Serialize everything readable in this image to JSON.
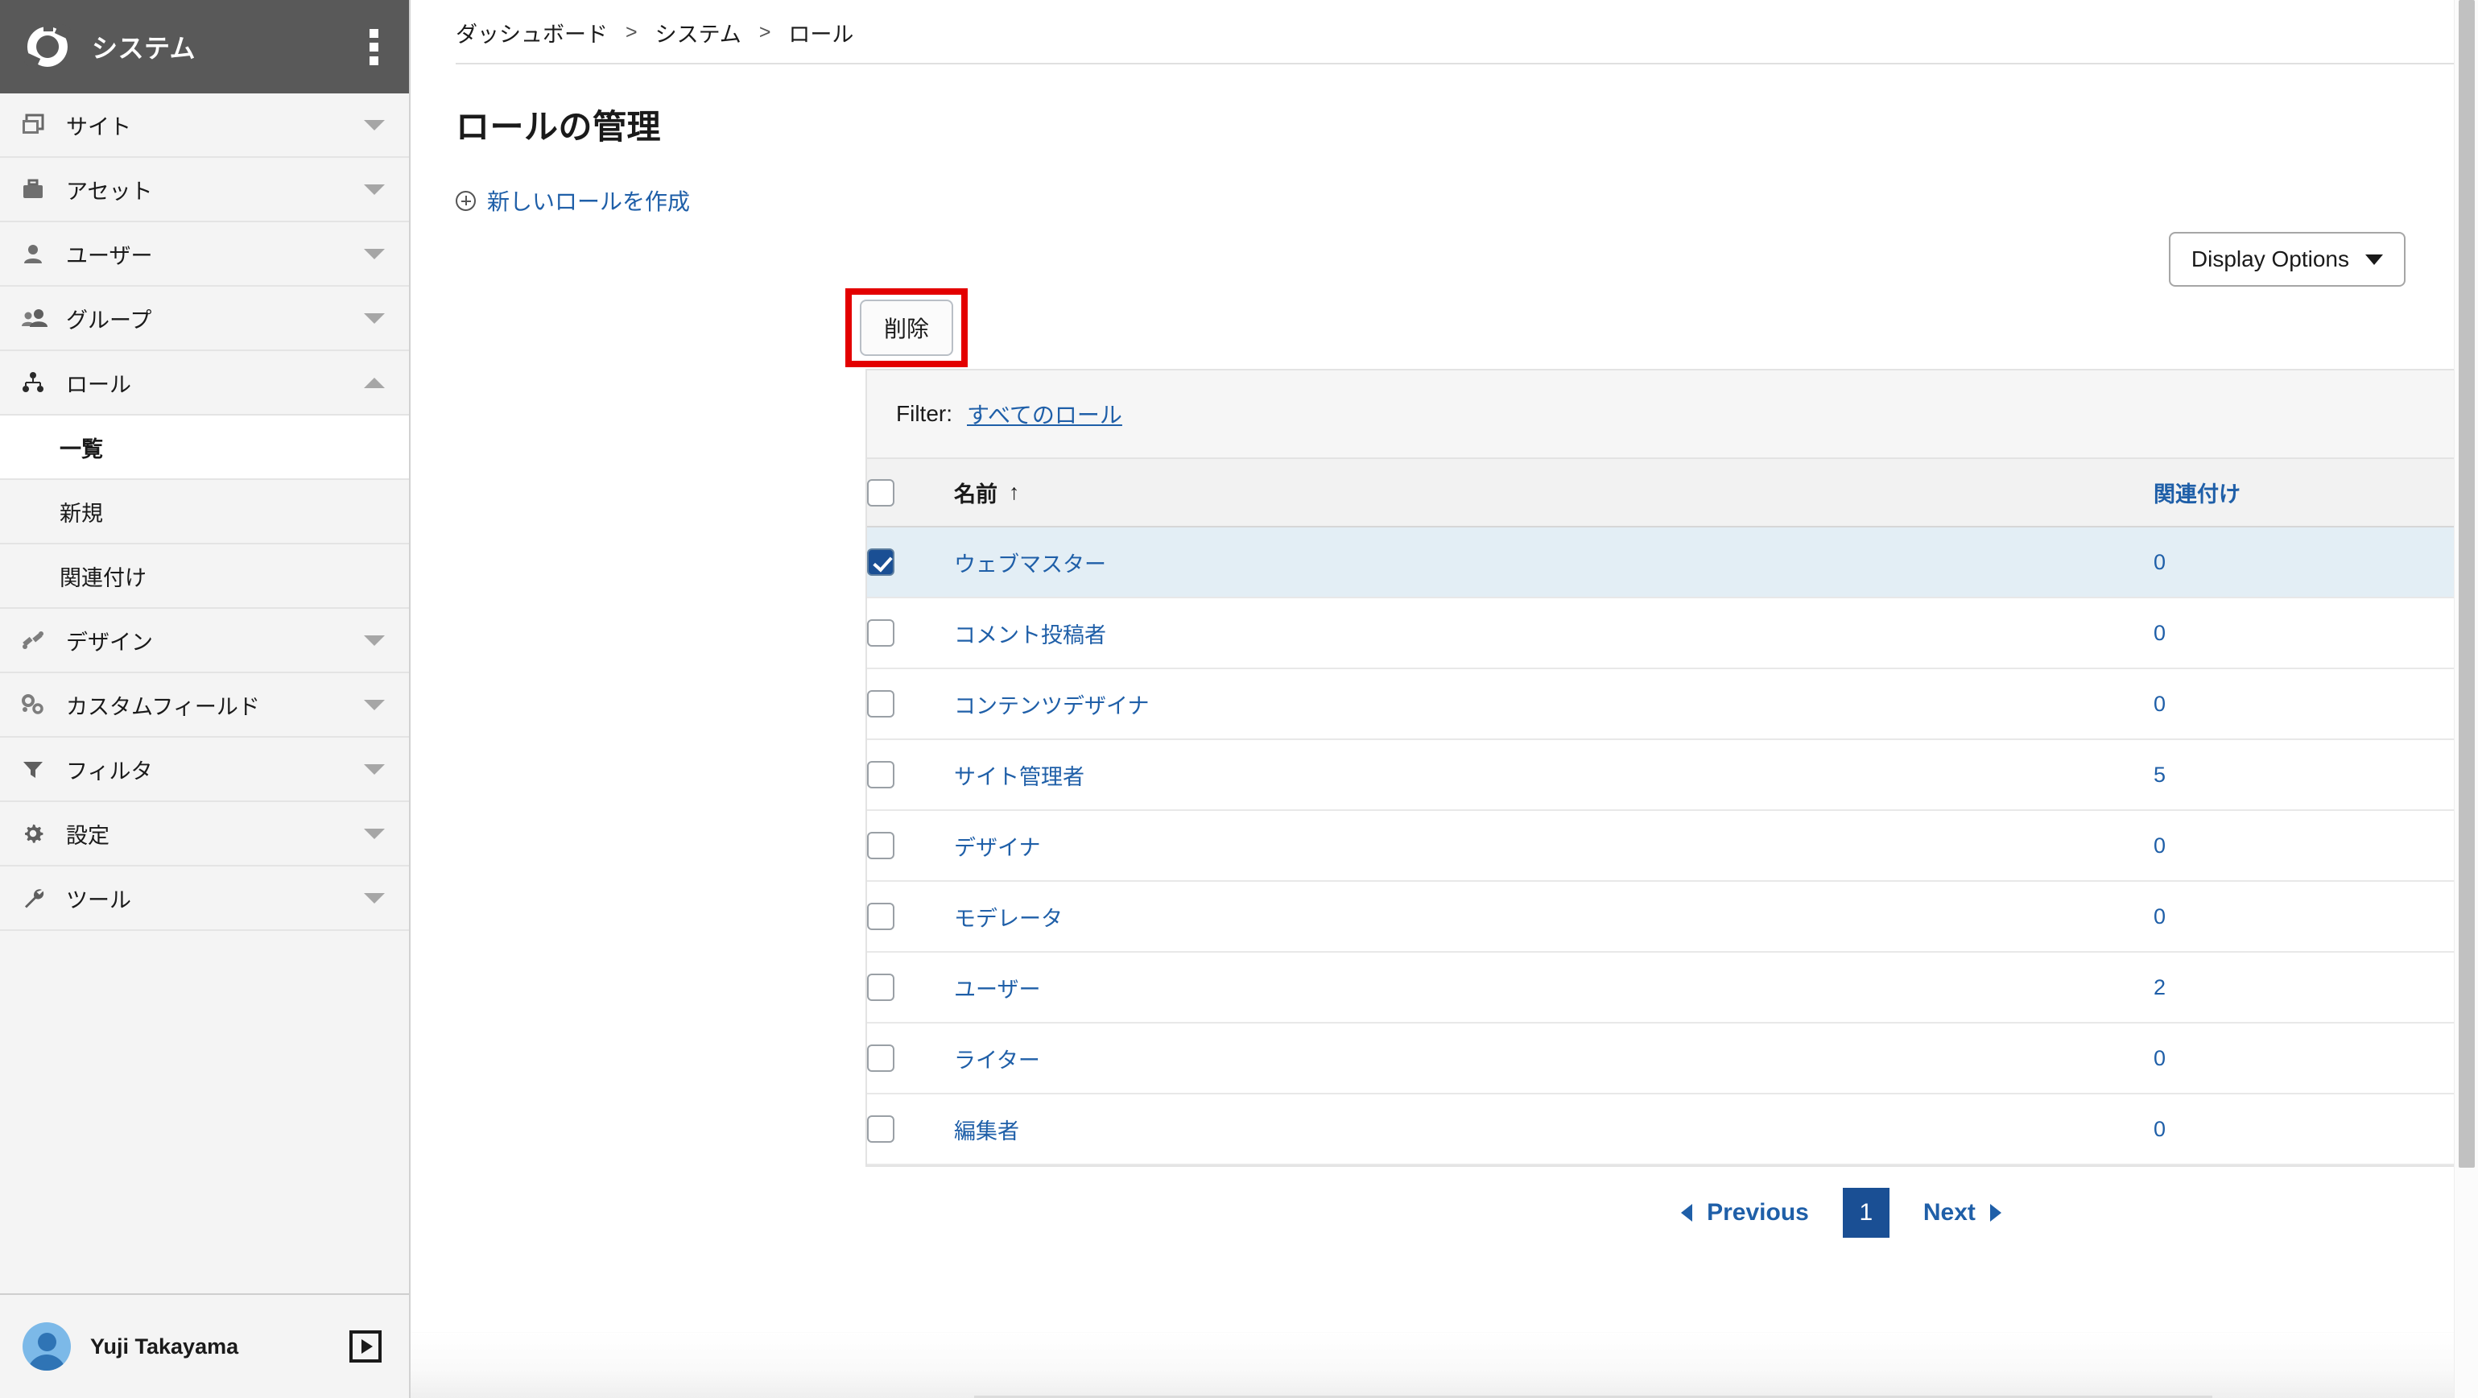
{
  "sidebar": {
    "brand": {
      "title": "システム",
      "logo_icon": "ring-logo-icon",
      "menu_icon": "kebab-menu-icon"
    },
    "items": [
      {
        "label": "サイト",
        "icon": "pages-icon",
        "expanded": false
      },
      {
        "label": "アセット",
        "icon": "briefcase-icon",
        "expanded": false
      },
      {
        "label": "ユーザー",
        "icon": "user-icon",
        "expanded": false
      },
      {
        "label": "グループ",
        "icon": "group-icon",
        "expanded": false
      },
      {
        "label": "ロール",
        "icon": "roles-tree-icon",
        "expanded": true
      },
      {
        "label": "デザイン",
        "icon": "design-icon",
        "expanded": false
      },
      {
        "label": "カスタムフィールド",
        "icon": "custom-fields-icon",
        "expanded": false
      },
      {
        "label": "フィルタ",
        "icon": "filter-funnel-icon",
        "expanded": false
      },
      {
        "label": "設定",
        "icon": "gear-icon",
        "expanded": false
      },
      {
        "label": "ツール",
        "icon": "wrench-icon",
        "expanded": false
      }
    ],
    "roles_subitems": [
      {
        "label": "一覧",
        "active": true
      },
      {
        "label": "新規",
        "active": false
      },
      {
        "label": "関連付け",
        "active": false
      }
    ],
    "footer": {
      "user_name": "Yuji Takayama",
      "avatar_icon": "user-avatar-icon",
      "logout_icon": "logout-arrow-icon"
    }
  },
  "breadcrumb": {
    "items": [
      "ダッシュボード",
      "システム",
      "ロール"
    ],
    "separator": ">"
  },
  "page": {
    "title": "ロールの管理",
    "create_link": "新しいロールを作成",
    "create_icon": "plus-circle-icon"
  },
  "toolbar": {
    "display_options_label": "Display Options",
    "display_options_icon": "caret-down-icon",
    "delete_label": "削除",
    "highlight_color": "#e30000"
  },
  "filter_bar": {
    "label": "Filter:",
    "value": "すべてのロール",
    "toggle_icon": "caret-down-icon"
  },
  "table": {
    "columns": [
      {
        "key": "check",
        "label": ""
      },
      {
        "key": "name",
        "label": "名前",
        "sort": "↑",
        "sorted": true
      },
      {
        "key": "assoc",
        "label": "関連付け"
      }
    ],
    "header_checkbox_checked": false,
    "rows": [
      {
        "name": "ウェブマスター",
        "assoc": "0",
        "checked": true,
        "selected": true
      },
      {
        "name": "コメント投稿者",
        "assoc": "0",
        "checked": false,
        "selected": false
      },
      {
        "name": "コンテンツデザイナ",
        "assoc": "0",
        "checked": false,
        "selected": false
      },
      {
        "name": "サイト管理者",
        "assoc": "5",
        "checked": false,
        "selected": false
      },
      {
        "name": "デザイナ",
        "assoc": "0",
        "checked": false,
        "selected": false
      },
      {
        "name": "モデレータ",
        "assoc": "0",
        "checked": false,
        "selected": false
      },
      {
        "name": "ユーザー",
        "assoc": "2",
        "checked": false,
        "selected": false
      },
      {
        "name": "ライター",
        "assoc": "0",
        "checked": false,
        "selected": false
      },
      {
        "name": "編集者",
        "assoc": "0",
        "checked": false,
        "selected": false
      }
    ]
  },
  "pagination": {
    "previous_label": "Previous",
    "next_label": "Next",
    "current_page": "1",
    "prev_icon": "triangle-left-icon",
    "next_icon": "triangle-right-icon"
  },
  "colors": {
    "link_blue": "#1f5fa8",
    "accent_blue": "#1a4f94",
    "selected_row": "#e3eef5",
    "header_gray": "#595959",
    "annotation_red": "#e30000"
  }
}
